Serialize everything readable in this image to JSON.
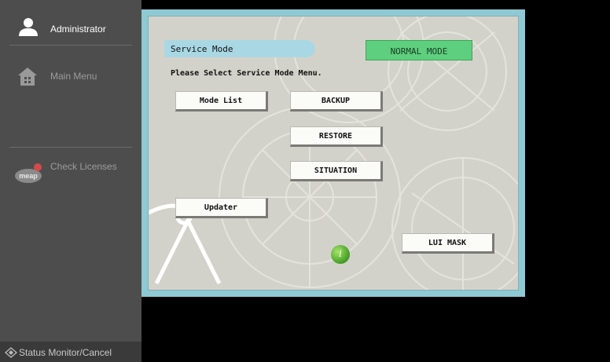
{
  "sidebar": {
    "user": {
      "label": "Administrator",
      "icon": "user-icon"
    },
    "main_menu": {
      "label": "Main Menu",
      "icon": "home-icon"
    },
    "check_licenses": {
      "label": "Check Licenses",
      "icon": "meap-logo-icon",
      "logo_text": "meap"
    },
    "status_monitor": {
      "label": "Status Monitor/Cancel",
      "icon": "status-monitor-icon"
    }
  },
  "service": {
    "title": "Service Mode",
    "mode_badge": "NORMAL MODE",
    "prompt": "Please Select Service Mode Menu.",
    "buttons": {
      "mode_list": "Mode List",
      "backup": "BACKUP",
      "restore": "RESTORE",
      "situation": "SITUATION",
      "updater": "Updater",
      "lui_mask": "LUI MASK"
    },
    "info_glyph": "i"
  },
  "colors": {
    "sidebar_bg": "#4d4d4d",
    "panel_border": "#8ec9d4",
    "panel_bg": "#d3d2ca",
    "title_bar": "#a9d8e4",
    "mode_badge": "#5ecf7e"
  }
}
